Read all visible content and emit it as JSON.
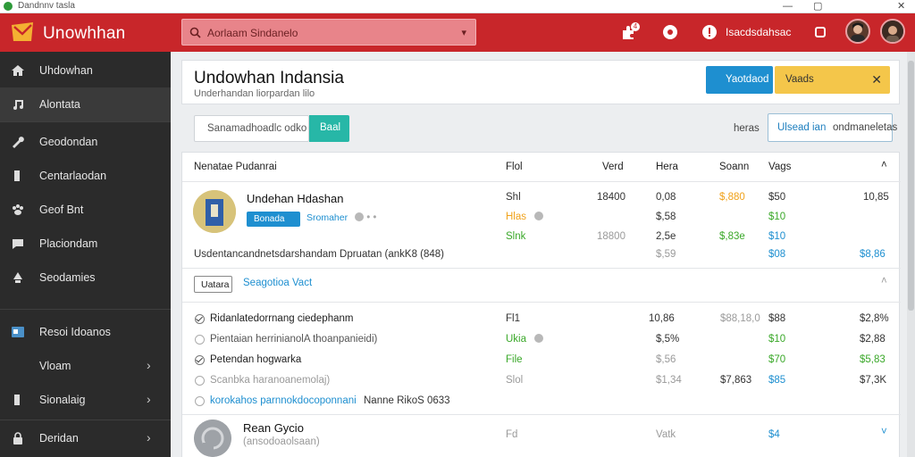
{
  "window": {
    "title": "Dandnnv tasla",
    "minimize": "—",
    "restore": "▢",
    "close": "✕"
  },
  "header": {
    "app_name": "Unowhhan",
    "search_placeholder": "Aorlaam Sindanelo",
    "notification_count": "4",
    "user_label": "Isacdsdahsac",
    "brand_color": "#c8262a"
  },
  "sidebar": {
    "items": [
      {
        "label": "Uhdowhan",
        "icon": "home-icon"
      },
      {
        "label": "Alontata",
        "icon": "music-icon"
      },
      {
        "label": "Geodondan",
        "icon": "wrench-icon"
      },
      {
        "label": "Centarlaodan",
        "icon": "bookmark-icon"
      },
      {
        "label": "Geof Bnt",
        "icon": "paw-icon"
      },
      {
        "label": "Placiondam",
        "icon": "chat-icon"
      },
      {
        "label": "Seodamies",
        "icon": "recycle-icon"
      },
      {
        "label": "Resoi Idoanos",
        "icon": "card-icon"
      },
      {
        "label": "Vloam",
        "icon": ""
      },
      {
        "label": "Sionalaig",
        "icon": "bookmark-icon"
      },
      {
        "label": "Deridan",
        "icon": "lock-icon"
      }
    ]
  },
  "page": {
    "title": "Undowhan Indansia",
    "subtitle": "Underhandan liorpardan lilo",
    "btn_primary": "Yaotdaod",
    "btn_warning": "Vaads",
    "filter_placeholder": "Sanamadhoadlc odko",
    "btn_filter": "Baal",
    "right_label": "heras",
    "btn_outline_1": "Ulsead ian",
    "btn_outline_2": "ondmaneletas"
  },
  "table": {
    "headers": [
      "Nenatae Pudanrai",
      "Flol",
      "Verd",
      "Hera",
      "Soann",
      "Vags"
    ],
    "item1": {
      "title": "Undehan Hdashan",
      "chip": "Bonada",
      "tag": "Sromaher",
      "row1": [
        "Shl",
        "18400",
        "0,08",
        "$,880",
        "$50",
        "10,85"
      ],
      "row2": [
        "Hlas",
        "",
        "$,58",
        "",
        "$10",
        ""
      ],
      "row3": [
        "Slnk",
        "18800",
        "2,5e",
        "$,83e",
        "$10",
        ""
      ],
      "desc": "Usdentancandnetsdarshandam Dpruatan (ankK8 (848)",
      "row4": [
        "",
        "",
        "$,59",
        "",
        "$08",
        "$8,86"
      ]
    },
    "section": {
      "tag": "Uatara",
      "label": "Seagotioa Vact"
    },
    "rows": [
      {
        "text": "Ridanlatedorrnang ciedephanm",
        "c1": "Fl1",
        "c2": "10,86",
        "c3": "$88,18,0",
        "c4": "$88",
        "c5": "$2,8%",
        "checked": true
      },
      {
        "text": "Pientaian herrinianolA thoanpanieidi)",
        "c1": "Ukia",
        "c2": "$,5%",
        "c3": "",
        "c4": "$10",
        "c5": "$2,88",
        "checked": false
      },
      {
        "text": "Petendan hogwarka",
        "c1": "File",
        "c2": "$,56",
        "c3": "",
        "c4": "$70",
        "c5": "$5,83",
        "checked": true
      },
      {
        "text": "Scanbka haranoanemolaj)",
        "c1": "Slol",
        "c2": "$1,34",
        "c3": "$7,863",
        "c4": "$85",
        "c5": "$7,3K",
        "checked": false
      },
      {
        "text_blue": "korokahos parnnokdocoponnani",
        "text_rest": "Nanne RikoS 0633",
        "c1": "",
        "c2": "",
        "c3": "",
        "c4": "",
        "c5": "",
        "checked": false
      }
    ],
    "last": {
      "title": "Rean Gycio",
      "sub": "(ansodoaolsaan)",
      "c1": "Fd",
      "c2": "Vatk",
      "c3": "$4"
    }
  }
}
